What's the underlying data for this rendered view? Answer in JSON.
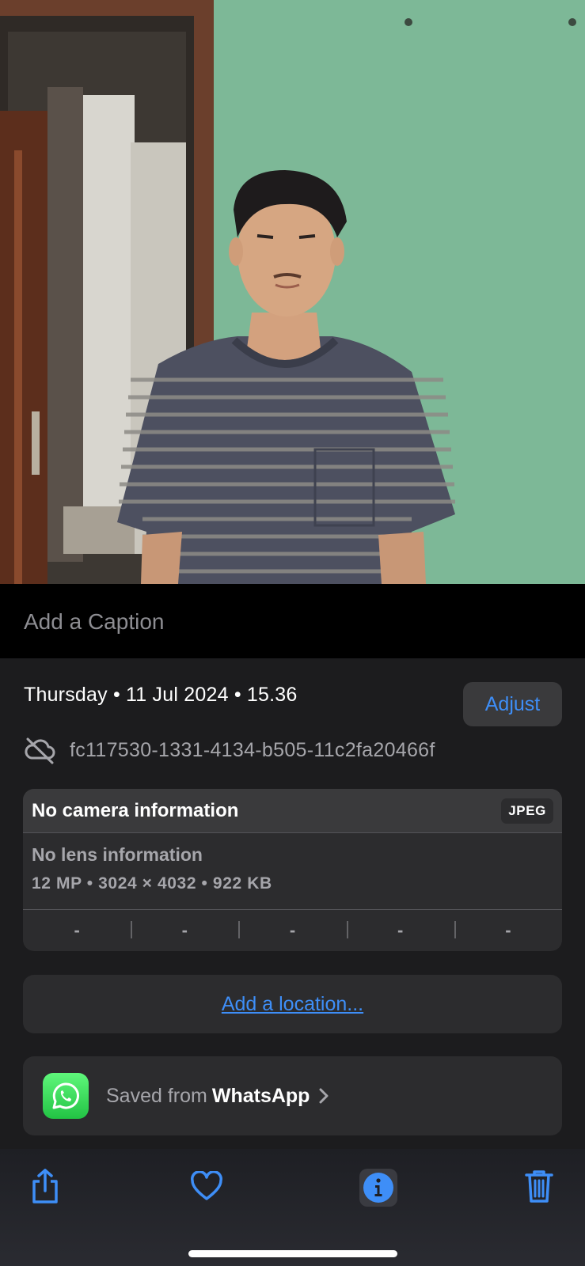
{
  "photo": {
    "subject": "photo-portrait"
  },
  "caption": {
    "placeholder": "Add a Caption"
  },
  "info": {
    "date_line": "Thursday • 11 Jul 2024 • 15.36",
    "adjust_label": "Adjust",
    "file_name": "fc117530-1331-4134-b505-11c2fa20466f",
    "file_icon": "cloud-slash-icon"
  },
  "camera": {
    "title": "No camera information",
    "format": "JPEG",
    "lens": "No lens information",
    "specs": "12 MP  •  3024 × 4032  •  922 KB",
    "exif": [
      "-",
      "-",
      "-",
      "-",
      "-"
    ]
  },
  "location": {
    "link_label": "Add a location..."
  },
  "source": {
    "prefix": "Saved from",
    "app": "WhatsApp",
    "icon": "whatsapp-icon"
  },
  "toolbar": {
    "share_icon": "share-icon",
    "favorite_icon": "heart-icon",
    "info_icon": "info-icon",
    "delete_icon": "trash-icon"
  },
  "colors": {
    "accent": "#3e8ef7",
    "panel_bg": "#1c1c1e",
    "card_bg": "#2c2c2e",
    "secondary_text": "#a6a6ab",
    "whatsapp_green": "#25d366"
  }
}
